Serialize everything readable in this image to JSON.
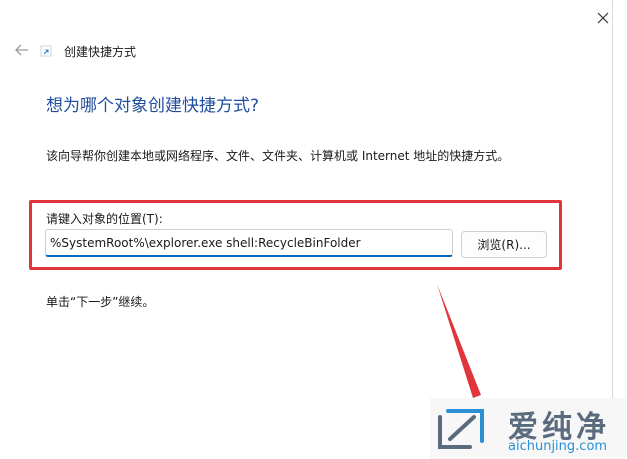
{
  "wizard": {
    "title": "创建快捷方式",
    "heading": "想为哪个对象创建快捷方式?",
    "description": "该向导帮你创建本地或网络程序、文件、文件夹、计算机或 Internet 地址的快捷方式。",
    "location_label": "请键入对象的位置(T):",
    "location_value": "%SystemRoot%\\explorer.exe shell:RecycleBinFolder",
    "browse_label": "浏览(R)...",
    "continue_text": "单击“下一步”继续。"
  },
  "icons": {
    "close": "close-icon",
    "back": "back-arrow-icon",
    "wizard": "shortcut-icon"
  },
  "annotation": {
    "highlight_color": "#e0353b"
  },
  "watermark": {
    "brand": "爱纯净",
    "url": "aichunjing.com",
    "brand_color": "#5a6b7e",
    "url_color": "#2a8fd6"
  }
}
